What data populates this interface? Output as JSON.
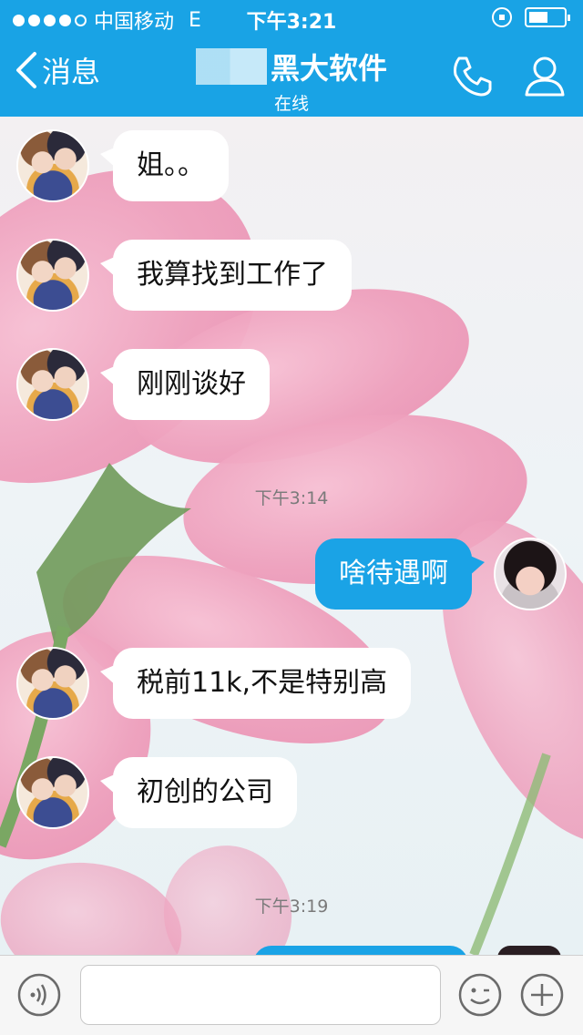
{
  "status_bar": {
    "carrier": "中国移动",
    "network": "E",
    "time": "下午3:21",
    "battery_level": 0.55
  },
  "header": {
    "back_label": "消息",
    "title": "黑大软件",
    "subtitle": "在线"
  },
  "messages": [
    {
      "side": "in",
      "text": "姐。。"
    },
    {
      "side": "in",
      "text": "我算找到工作了"
    },
    {
      "side": "in",
      "text": "刚刚谈好"
    },
    {
      "side": "out",
      "text": "啥待遇啊"
    },
    {
      "side": "in",
      "text": "税前11k,不是特别高"
    },
    {
      "side": "in",
      "text": "初创的公司"
    }
  ],
  "timestamps": [
    "下午3:14",
    "下午3:19"
  ],
  "input": {
    "value": "",
    "placeholder": ""
  },
  "colors": {
    "accent": "#19a3e5",
    "outgoing_bubble": "#1aa3e6",
    "incoming_bubble": "#ffffff"
  },
  "icons": {
    "back": "chevron-left-icon",
    "call": "phone-icon",
    "contact": "person-icon",
    "voice": "voice-icon",
    "emoji": "emoji-icon",
    "more": "plus-icon"
  }
}
